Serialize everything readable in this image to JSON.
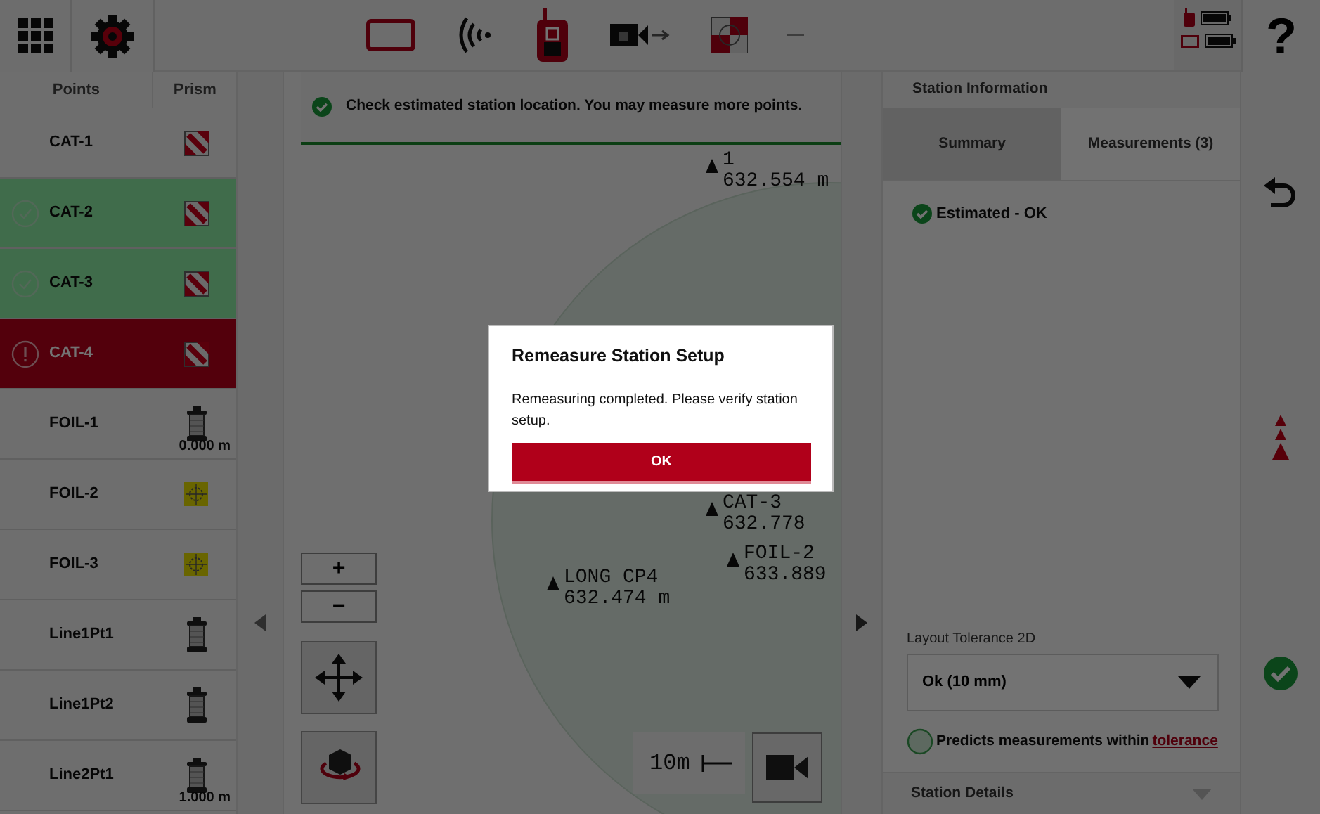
{
  "top_bar": {
    "help": "?"
  },
  "points_table": {
    "columns": [
      "Points",
      "Prism"
    ],
    "rows": [
      {
        "name": "CAT-1",
        "kind": "cat",
        "measured": false,
        "failed": false
      },
      {
        "name": "CAT-2",
        "kind": "cat",
        "measured": true,
        "failed": false
      },
      {
        "name": "CAT-3",
        "kind": "cat",
        "measured": true,
        "failed": false
      },
      {
        "name": "CAT-4",
        "kind": "cat",
        "measured": false,
        "failed": true
      },
      {
        "name": "FOIL-1",
        "kind": "pole",
        "measured": false,
        "failed": false,
        "height": "0.000 m"
      },
      {
        "name": "FOIL-2",
        "kind": "foil",
        "measured": false,
        "failed": false
      },
      {
        "name": "FOIL-3",
        "kind": "foil",
        "measured": false,
        "failed": false
      },
      {
        "name": "Line1Pt1",
        "kind": "pole",
        "measured": false,
        "failed": false
      },
      {
        "name": "Line1Pt2",
        "kind": "pole",
        "measured": false,
        "failed": false
      },
      {
        "name": "Line2Pt1",
        "kind": "pole",
        "measured": false,
        "failed": false,
        "height": "1.000 m"
      }
    ]
  },
  "notification": {
    "text": "Check estimated station location. You may measure more points."
  },
  "map": {
    "points": [
      {
        "label": "1",
        "elevation": "632.554 m"
      },
      {
        "label": "CAT-3",
        "elevation": "632.778"
      },
      {
        "label": "FOIL-2",
        "elevation": "633.889"
      },
      {
        "label": "LONG CP4",
        "elevation": "632.474 m"
      }
    ],
    "zoom_in": "+",
    "zoom_out": "−",
    "scale": "10m"
  },
  "station_info": {
    "title": "Station Information",
    "tabs": [
      {
        "label": "Summary",
        "selected": true
      },
      {
        "label": "Measurements (3)",
        "selected": false
      }
    ],
    "status": "Estimated - OK",
    "tolerance_label": "Layout Tolerance 2D",
    "tolerance_value": "Ok (10 mm)",
    "prediction_text": "Predicts measurements within",
    "prediction_link": "tolerance",
    "details_title": "Station Details"
  },
  "dialog": {
    "title": "Remeasure Station Setup",
    "message": "Remeasuring completed. Please verify station setup.",
    "button": "OK"
  }
}
